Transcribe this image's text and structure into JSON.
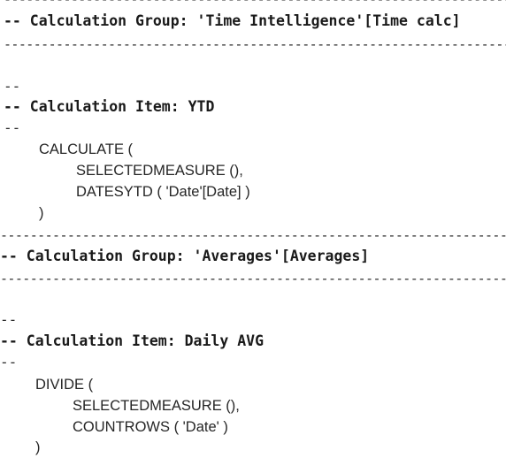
{
  "block1": {
    "separator_top": "--------------------------------------------------------------------",
    "group_header": "-- Calculation Group: 'Time Intelligence'[Time calc]",
    "separator_bottom": "--------------------------------------------------------------------",
    "comment_open": "--",
    "item_header": "-- Calculation Item: YTD",
    "comment_close": "--",
    "code": [
      "CALCULATE (",
      "SELECTEDMEASURE (),",
      "DATESYTD ( 'Date'[Date] )",
      ")"
    ]
  },
  "block2": {
    "separator_top": "--------------------------------------------------------------------",
    "group_header": "-- Calculation Group: 'Averages'[Averages]",
    "separator_bottom": "--------------------------------------------------------------------",
    "comment_open": "--",
    "item_header": "-- Calculation Item: Daily AVG",
    "comment_close": "--",
    "code": [
      "DIVIDE (",
      "SELECTEDMEASURE (),",
      "COUNTROWS ( 'Date' )",
      ")"
    ]
  }
}
